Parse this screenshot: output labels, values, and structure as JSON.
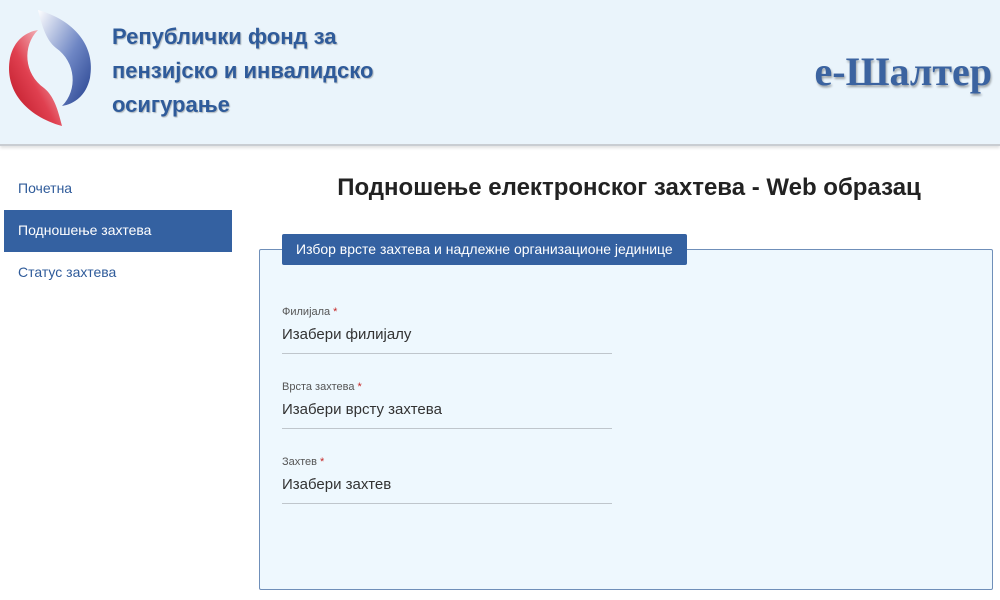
{
  "header": {
    "org_name_lines": [
      "Републички фонд за",
      "пензијско и инвалидско",
      "осигурање"
    ],
    "brand": "е-Шалтер",
    "logo_icon": "pio-logo-icon",
    "colors": {
      "brand_blue": "#2f5b9a",
      "logo_red": "#c8102e",
      "header_bg": "#eaf4fb"
    }
  },
  "sidebar": {
    "items": [
      {
        "label": "Почетна",
        "active": false
      },
      {
        "label": "Подношење захтева",
        "active": true
      },
      {
        "label": "Статус захтева",
        "active": false
      }
    ],
    "active_color": "#3461a1"
  },
  "main": {
    "title": "Подношење електронског захтева - Web образац",
    "panel": {
      "legend": "Избор врсте захтева и надлежне организационе јединице",
      "fields": [
        {
          "label": "Филијала",
          "required_mark": "*",
          "value": "Изабери филијалу"
        },
        {
          "label": "Врста захтева",
          "required_mark": "*",
          "value": "Изабери врсту захтева"
        },
        {
          "label": "Захтев",
          "required_mark": "*",
          "value": "Изабери захтев"
        }
      ]
    }
  }
}
